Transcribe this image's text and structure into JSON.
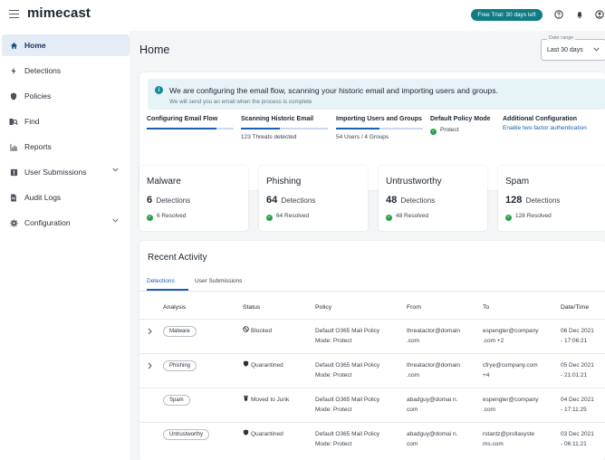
{
  "header": {
    "logo": "mimecast",
    "trial_badge": "Free Trial: 30 days left",
    "icons": [
      "help-icon",
      "notifications-icon",
      "account-icon"
    ]
  },
  "sidebar": {
    "items": [
      {
        "label": "Home",
        "icon": "home-icon",
        "active": true
      },
      {
        "label": "Detections",
        "icon": "bolt-icon"
      },
      {
        "label": "Policies",
        "icon": "shield-icon"
      },
      {
        "label": "Find",
        "icon": "find-icon"
      },
      {
        "label": "Reports",
        "icon": "chart-icon"
      },
      {
        "label": "User Submissions",
        "icon": "submission-icon",
        "expandable": true
      },
      {
        "label": "Audit Logs",
        "icon": "document-icon"
      },
      {
        "label": "Configuration",
        "icon": "gear-icon",
        "expandable": true
      }
    ]
  },
  "main": {
    "title": "Home",
    "date_range": {
      "label": "Date range",
      "value": "Last 30 days"
    }
  },
  "setup": {
    "banner_title": "We are configuring the email flow, scanning your historic email and importing users and groups.",
    "banner_sub": "We will send you an email when the process is complete",
    "steps": [
      {
        "title": "Configuring Email Flow",
        "progress": 0.8,
        "detail": ""
      },
      {
        "title": "Scanning Historic Email",
        "progress": 0.45,
        "detail": "123 Threats detected"
      },
      {
        "title": "Importing Users and Groups",
        "progress": 0.5,
        "detail": "54 Users / 4 Groups"
      },
      {
        "title": "Default Policy Mode",
        "detail": "Protect"
      },
      {
        "title": "Additional Configuration",
        "link": "Enable two-factor authentication"
      }
    ]
  },
  "stats": [
    {
      "name": "Malware",
      "count": "6",
      "count_label": "Detections",
      "resolved": "6 Resolved"
    },
    {
      "name": "Phishing",
      "count": "64",
      "count_label": "Detections",
      "resolved": "64 Resolved"
    },
    {
      "name": "Untrustworthy",
      "count": "48",
      "count_label": "Detections",
      "resolved": "48 Resolved"
    },
    {
      "name": "Spam",
      "count": "128",
      "count_label": "Detections",
      "resolved": "128 Resolved"
    }
  ],
  "activity": {
    "title": "Recent Activity",
    "tabs": [
      "Detections",
      "User Submissions"
    ],
    "columns": [
      "Analysis",
      "Status",
      "Policy",
      "From",
      "To",
      "Date/Time"
    ],
    "rows": [
      {
        "analysis": "Malware",
        "status": "Blocked",
        "status_icon": "blocked-icon",
        "policy1": "Default O365 Mail Policy",
        "policy2": "Mode: Protect",
        "from1": "threatactor@domain",
        "from2": ".com",
        "to1": "espengler@company",
        "to2": ".com +2",
        "date1": "06 Dec 2021",
        "date2": "- 17:06:21"
      },
      {
        "analysis": "Phishing",
        "status": "Quarantined",
        "status_icon": "shield-icon",
        "policy1": "Default O365 Mail Policy",
        "policy2": "Mode: Protect",
        "from1": "threatactor@domain",
        "from2": ".com",
        "to1": "cfrye@company.com",
        "to2": "+4",
        "date1": "05 Dec 2021",
        "date2": "- 21:01:21"
      },
      {
        "analysis": "Spam",
        "status": "Moved to Junk",
        "status_icon": "trash-icon",
        "policy1": "Default O365 Mail Policy",
        "policy2": "Mode: Protect",
        "from1": "abadguy@domai n.",
        "from2": "com",
        "to1": "espengler@company",
        "to2": ".com",
        "date1": "04 Dec 2021",
        "date2": "- 17:11:25"
      },
      {
        "analysis": "Untrustworthy",
        "status": "Quarantined",
        "status_icon": "shield-icon",
        "policy1": "Default O365 Mail Policy",
        "policy2": "Mode: Protect",
        "from1": "abadguy@domai n.",
        "from2": "com",
        "to1": "rstantz@prollasyste",
        "to2": "ms.com",
        "date1": "03 Dec 2021",
        "date2": "- 06:11:21"
      }
    ]
  },
  "colors": {
    "accent": "#1a5fb4",
    "trial": "#0f7c84",
    "success": "#2b9e4b"
  }
}
